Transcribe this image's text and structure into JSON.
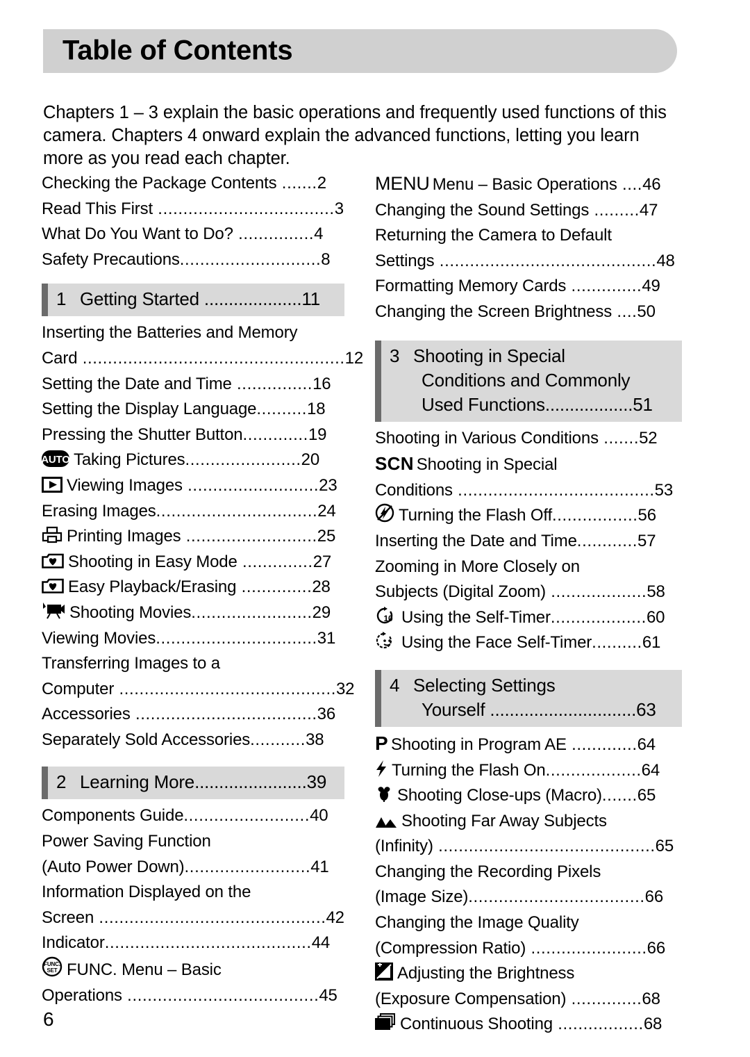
{
  "page": {
    "title": "Table of Contents",
    "number": "6",
    "intro": "Chapters 1 – 3 explain the basic operations and frequently used functions of this camera. Chapters 4 onward explain the advanced functions, letting you learn more as you read each chapter."
  },
  "left_column": {
    "front_matter": [
      {
        "label": "Checking the Package Contents",
        "leader": " .......",
        "page": "2"
      },
      {
        "label": "Read This First",
        "leader": " ...................................",
        "page": "3"
      },
      {
        "label": "What Do You Want to Do?",
        "leader": " ...............",
        "page": "4"
      },
      {
        "label": "Safety Precautions",
        "leader": "............................",
        "page": "8"
      }
    ],
    "chapter1": {
      "number": "1",
      "title": "Getting Started",
      "leader": " ....................",
      "page": "11"
    },
    "chapter1_entries": [
      {
        "icon": "",
        "line1": "Inserting the Batteries and Memory",
        "label": "Card",
        "leader": " ....................................................",
        "page": "12"
      },
      {
        "icon": "",
        "label": "Setting the Date and Time",
        "leader": " ...............",
        "page": "16"
      },
      {
        "icon": "",
        "label": "Setting the Display Language",
        "leader": "..........",
        "page": "18"
      },
      {
        "icon": "",
        "label": "Pressing the Shutter Button",
        "leader": ".............",
        "page": "19"
      },
      {
        "icon": "auto-mode-icon",
        "label": "Taking Pictures",
        "leader": ".......................",
        "page": "20"
      },
      {
        "icon": "playback-icon",
        "label": "Viewing Images",
        "leader": " ..........................",
        "page": "23"
      },
      {
        "icon": "",
        "label": "Erasing Images",
        "leader": "................................",
        "page": "24"
      },
      {
        "icon": "print-icon",
        "label": "Printing Images",
        "leader": " ..........................",
        "page": "25"
      },
      {
        "icon": "easy-mode-icon",
        "label": "Shooting in Easy Mode",
        "leader": " ..............",
        "page": "27"
      },
      {
        "icon": "easy-mode-icon",
        "label": "Easy Playback/Erasing",
        "leader": " ..............",
        "page": "28"
      },
      {
        "icon": "movie-icon",
        "label": "Shooting Movies",
        "leader": "........................",
        "page": "29"
      },
      {
        "icon": "",
        "label": "Viewing Movies",
        "leader": "................................",
        "page": "31"
      },
      {
        "icon": "",
        "line1": "Transferring Images to a",
        "label": "Computer",
        "leader": " ...........................................",
        "page": "32"
      },
      {
        "icon": "",
        "label": "Accessories",
        "leader": " ....................................",
        "page": "36"
      },
      {
        "icon": "",
        "label": "Separately Sold Accessories",
        "leader": "...........",
        "page": "38"
      }
    ],
    "chapter2": {
      "number": "2",
      "title": "Learning More",
      "leader": ".......................",
      "page": "39"
    },
    "chapter2_entries": [
      {
        "icon": "",
        "label": "Components Guide",
        "leader": ".........................",
        "page": "40"
      },
      {
        "icon": "",
        "line1": "Power Saving Function",
        "label": "(Auto Power Down)",
        "leader": ".........................",
        "page": "41"
      },
      {
        "icon": "",
        "line1": "Information Displayed on the",
        "label": "Screen",
        "leader": " .............................................",
        "page": "42"
      },
      {
        "icon": "",
        "label": "Indicator",
        "leader": ".........................................",
        "page": "44"
      },
      {
        "icon": "func-set-icon",
        "line1": "FUNC. Menu – Basic",
        "label": "Operations",
        "leader": " ......................................",
        "page": "45"
      }
    ]
  },
  "right_column": {
    "chapter2_cont": [
      {
        "icon": "menu-text-icon",
        "icon_text": "MENU",
        "label": "Menu – Basic Operations",
        "leader": " ....",
        "page": "46"
      },
      {
        "icon": "",
        "label": "Changing the Sound Settings",
        "leader": " .........",
        "page": "47"
      },
      {
        "icon": "",
        "line1": "Returning the Camera to Default",
        "label": "Settings",
        "leader": " ...........................................",
        "page": "48"
      },
      {
        "icon": "",
        "label": "Formatting Memory Cards",
        "leader": " ..............",
        "page": "49"
      },
      {
        "icon": "",
        "label": "Changing the Screen Brightness",
        "leader": " ....",
        "page": "50"
      }
    ],
    "chapter3": {
      "number": "3",
      "title_line1": "Shooting in Special",
      "title_line2": "Conditions and Commonly",
      "title_line3": "Used Functions",
      "leader": "..................",
      "page": "51"
    },
    "chapter3_entries": [
      {
        "icon": "",
        "label": "Shooting in Various Conditions",
        "leader": " .......",
        "page": "52"
      },
      {
        "icon": "scn-text-icon",
        "icon_text": "SCN",
        "line1": "Shooting in Special",
        "label": "Conditions",
        "leader": " .......................................",
        "page": "53"
      },
      {
        "icon": "flash-off-icon",
        "label": "Turning the Flash Off",
        "leader": ".................",
        "page": "56"
      },
      {
        "icon": "",
        "label": "Inserting the Date and Time",
        "leader": "............",
        "page": "57"
      },
      {
        "icon": "",
        "line1": "Zooming in More Closely on",
        "label": "Subjects (Digital Zoom)",
        "leader": " ...................",
        "page": "58"
      },
      {
        "icon": "self-timer-icon",
        "label": "Using the Self-Timer",
        "leader": "...................",
        "page": "60"
      },
      {
        "icon": "face-self-timer-icon",
        "label": "Using the Face Self-Timer",
        "leader": "..........",
        "page": "61"
      }
    ],
    "chapter4": {
      "number": "4",
      "title_line1": "Selecting Settings",
      "title_line2": "Yourself",
      "leader": " ..............................",
      "page": "63"
    },
    "chapter4_entries": [
      {
        "icon": "program-ae-icon",
        "icon_text": "P",
        "label": "Shooting in Program AE",
        "leader": " .............",
        "page": "64"
      },
      {
        "icon": "flash-on-icon",
        "label": "Turning the Flash On",
        "leader": "...................",
        "page": "64"
      },
      {
        "icon": "macro-icon",
        "label": "Shooting Close-ups (Macro)",
        "leader": ".......",
        "page": "65"
      },
      {
        "icon": "infinity-icon",
        "line1": "Shooting Far Away Subjects",
        "label": "(Infinity)",
        "leader": " ...........................................",
        "page": "65"
      },
      {
        "icon": "",
        "line1": "Changing the Recording Pixels",
        "label": "(Image Size)",
        "leader": "...................................",
        "page": "66"
      },
      {
        "icon": "",
        "line1": "Changing the Image Quality",
        "label": "(Compression Ratio)",
        "leader": " .......................",
        "page": "66"
      },
      {
        "icon": "exposure-compensation-icon",
        "line1": "Adjusting the Brightness",
        "label": "(Exposure Compensation)",
        "leader": " ..............",
        "page": "68"
      },
      {
        "icon": "continuous-shooting-icon",
        "label": "Continuous Shooting",
        "leader": " .................",
        "page": "68"
      }
    ]
  },
  "colors": {
    "banner_bg": "#d0d0d0",
    "chapter_box_bg": "#d9d9d9",
    "chapter_box_bar": "#6b6b6b",
    "text": "#000000"
  }
}
